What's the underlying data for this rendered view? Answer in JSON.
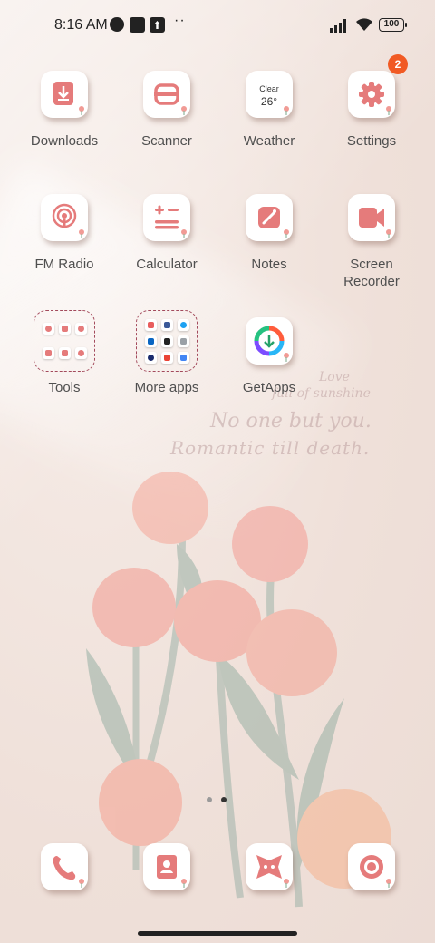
{
  "status_bar": {
    "time": "8:16 AM",
    "battery": "100"
  },
  "apps_row1": [
    {
      "label": "Downloads",
      "icon": "download-icon"
    },
    {
      "label": "Scanner",
      "icon": "scanner-icon"
    },
    {
      "label": "Weather",
      "icon": "weather-icon",
      "weather_text": "Clear",
      "temperature": "26°"
    },
    {
      "label": "Settings",
      "icon": "gear-icon",
      "badge": "2"
    }
  ],
  "apps_row2": [
    {
      "label": "FM Radio",
      "icon": "radio-icon"
    },
    {
      "label": "Calculator",
      "icon": "calculator-icon"
    },
    {
      "label": "Notes",
      "icon": "notes-icon"
    },
    {
      "label": "Screen\nRecorder",
      "icon": "video-camera-icon"
    }
  ],
  "apps_row3": [
    {
      "label": "Tools",
      "icon": "folder-icon"
    },
    {
      "label": "More apps",
      "icon": "folder-icon"
    },
    {
      "label": "GetApps",
      "icon": "getapps-icon"
    }
  ],
  "wallpaper_text": {
    "line1": "Love",
    "line2": "full of sunshine",
    "line3": "No one but you.",
    "line4": "Romantic till death."
  },
  "dock": [
    {
      "icon": "phone-icon"
    },
    {
      "icon": "contacts-icon"
    },
    {
      "icon": "gallery-icon"
    },
    {
      "icon": "camera-icon"
    }
  ],
  "colors": {
    "accent": "#e57b7b",
    "badge": "#f15a24",
    "dot_active": "#333333",
    "dot_inactive": "#9a9a9a"
  }
}
